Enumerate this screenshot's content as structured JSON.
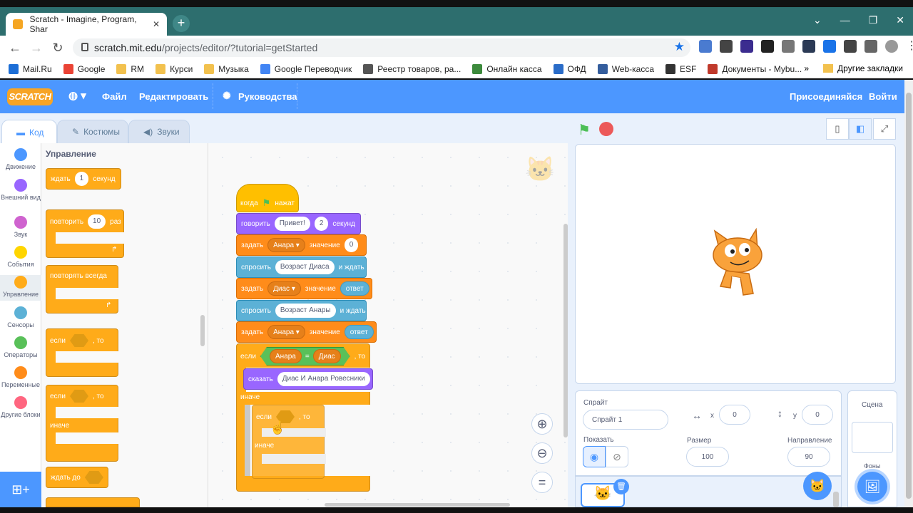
{
  "browser": {
    "tab_title": "Scratch - Imagine, Program, Shar",
    "url_host": "scratch.mit.edu",
    "url_path": "/projects/editor/?tutorial=getStarted",
    "bookmarks": [
      "Mail.Ru",
      "Google",
      "RM",
      "Курси",
      "Музыка",
      "Google Переводчик",
      "Реестр товаров, ра...",
      "Онлайн касса",
      "ОФД",
      "Web-касса",
      "ESF",
      "Документы - Mybu..."
    ],
    "bookmark_colors": [
      "#1c6ed6",
      "#ea4335",
      "#f2c14e",
      "#f2c14e",
      "#f2c14e",
      "#4285f4",
      "#555555",
      "#3c8a3c",
      "#2a6cc8",
      "#345d9d",
      "#333333",
      "#c0392b"
    ],
    "other_bookmarks": "Другие закладки",
    "more_chevron": "»"
  },
  "menubar": {
    "logo": "SCRATCH",
    "file": "Файл",
    "edit": "Редактировать",
    "tutorials": "Руководства",
    "join": "Присоединяйся",
    "signin": "Войти"
  },
  "tabs": {
    "code": "Код",
    "costumes": "Костюмы",
    "sounds": "Звуки"
  },
  "categories": [
    {
      "label": "Движение",
      "color": "#4c97ff"
    },
    {
      "label": "Внешний вид",
      "color": "#9966ff"
    },
    {
      "label": "Звук",
      "color": "#cf63cf"
    },
    {
      "label": "События",
      "color": "#ffd500"
    },
    {
      "label": "Управление",
      "color": "#ffab19"
    },
    {
      "label": "Сенсоры",
      "color": "#5cb1d6"
    },
    {
      "label": "Операторы",
      "color": "#59c059"
    },
    {
      "label": "Переменные",
      "color": "#ff8c1a"
    },
    {
      "label": "Другие блоки",
      "color": "#ff6680"
    }
  ],
  "palette": {
    "heading": "Управление",
    "wait": {
      "a": "ждать",
      "n": "1",
      "b": "секунд"
    },
    "repeat": {
      "a": "повторить",
      "n": "10",
      "b": "раз"
    },
    "forever": "повторять всегда",
    "if1": {
      "a": "если",
      "b": ", то"
    },
    "if2": {
      "a": "если",
      "b": ", то",
      "else": "иначе"
    },
    "until": "ждать до"
  },
  "script": {
    "hat": {
      "a": "когда",
      "b": "нажат"
    },
    "say": {
      "a": "говорить",
      "msg": "Привет!",
      "n": "2",
      "b": "секунд"
    },
    "set1": {
      "a": "задать",
      "var": "Анара",
      "b": "значение",
      "val": "0"
    },
    "ask1": {
      "a": "спросить",
      "q": "Возраст Диаса",
      "b": "и ждать"
    },
    "set2": {
      "a": "задать",
      "var": "Диас",
      "b": "значение",
      "val": "ответ"
    },
    "ask2": {
      "a": "спросить",
      "q": "Возраст Анары",
      "b": "и ждать"
    },
    "set3": {
      "a": "задать",
      "var": "Анара",
      "b": "значение",
      "val": "ответ"
    },
    "if": {
      "a": "если",
      "l": "Анара",
      "op": "=",
      "r": "Диас",
      "b": ", то"
    },
    "sayinner": {
      "a": "сказать",
      "msg": "Диас И Анара Ровесники"
    },
    "else": "иначе",
    "drag_if": {
      "a": "если",
      "b": ", то",
      "else": "иначе"
    }
  },
  "sprite_panel": {
    "sprite_label": "Спрайт",
    "sprite_name": "Спрайт 1",
    "x_label": "x",
    "x": "0",
    "y_label": "y",
    "y": "0",
    "show_label": "Показать",
    "size_label": "Размер",
    "size": "100",
    "direction_label": "Направление",
    "direction": "90"
  },
  "stage_panel": {
    "label": "Сцена",
    "backdrops": "Фоны"
  }
}
